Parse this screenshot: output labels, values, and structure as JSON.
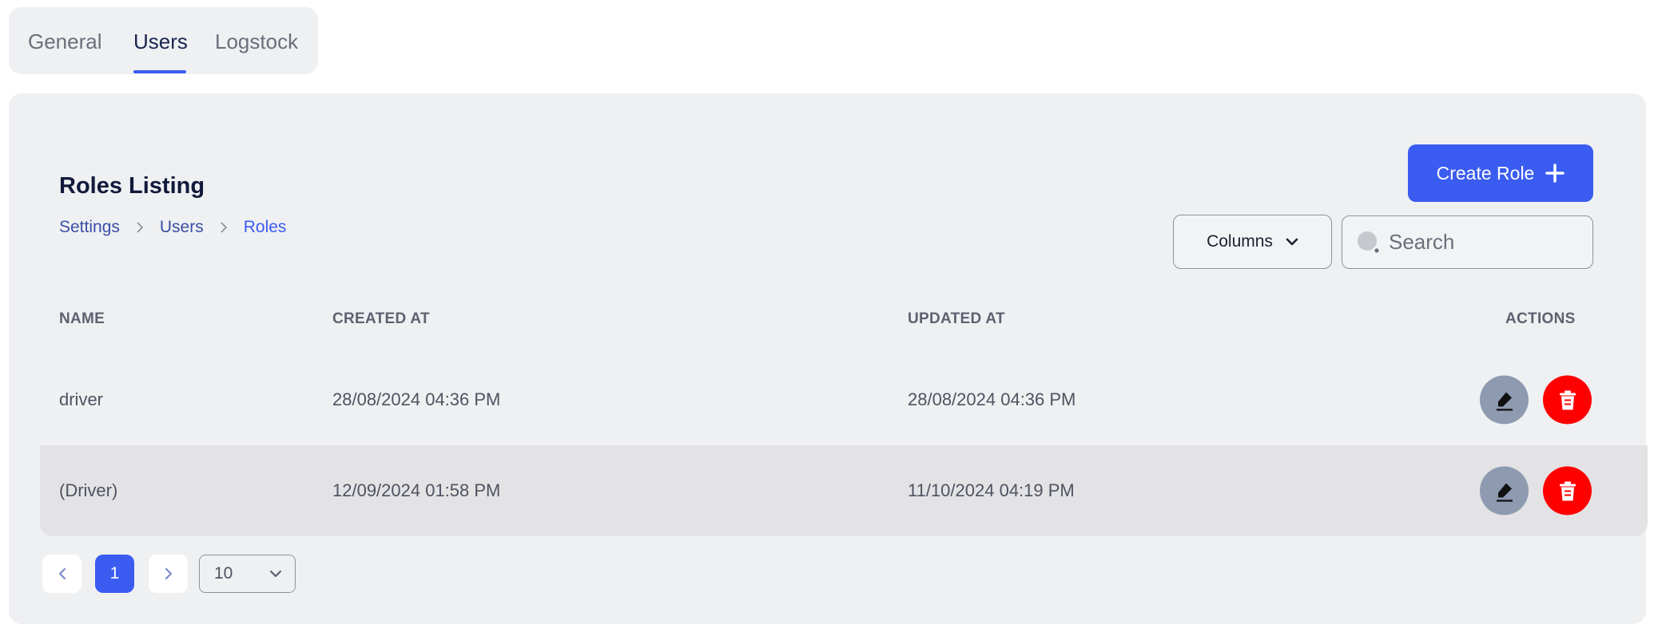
{
  "tabs": [
    {
      "label": "General",
      "active": false
    },
    {
      "label": "Users",
      "active": true
    },
    {
      "label": "Logstock",
      "active": false
    }
  ],
  "header": {
    "title": "Roles Listing",
    "breadcrumb": [
      "Settings",
      "Users",
      "Roles"
    ]
  },
  "toolbar": {
    "create_label": "Create Role",
    "columns_label": "Columns",
    "search_placeholder": "Search",
    "search_value": ""
  },
  "table": {
    "columns": [
      "NAME",
      "CREATED AT",
      "UPDATED AT",
      "ACTIONS"
    ],
    "rows": [
      {
        "name": "driver",
        "created_at": "28/08/2024 04:36 PM",
        "updated_at": "28/08/2024 04:36 PM"
      },
      {
        "name": "(Driver)",
        "created_at": "12/09/2024 01:58 PM",
        "updated_at": "11/10/2024 04:19 PM"
      }
    ]
  },
  "pagination": {
    "current_page": "1",
    "page_size": "10"
  },
  "icons": {
    "edit": "pen-icon",
    "delete": "trash-icon",
    "prev": "chevron-left-icon",
    "next": "chevron-right-icon",
    "dropdown": "chevron-down-icon",
    "search": "search-icon",
    "add": "plus-icon"
  },
  "colors": {
    "accent": "#3b5cf0",
    "danger": "#ff0000",
    "edit_button": "#8d9ab0",
    "panel": "#eff0f2"
  }
}
